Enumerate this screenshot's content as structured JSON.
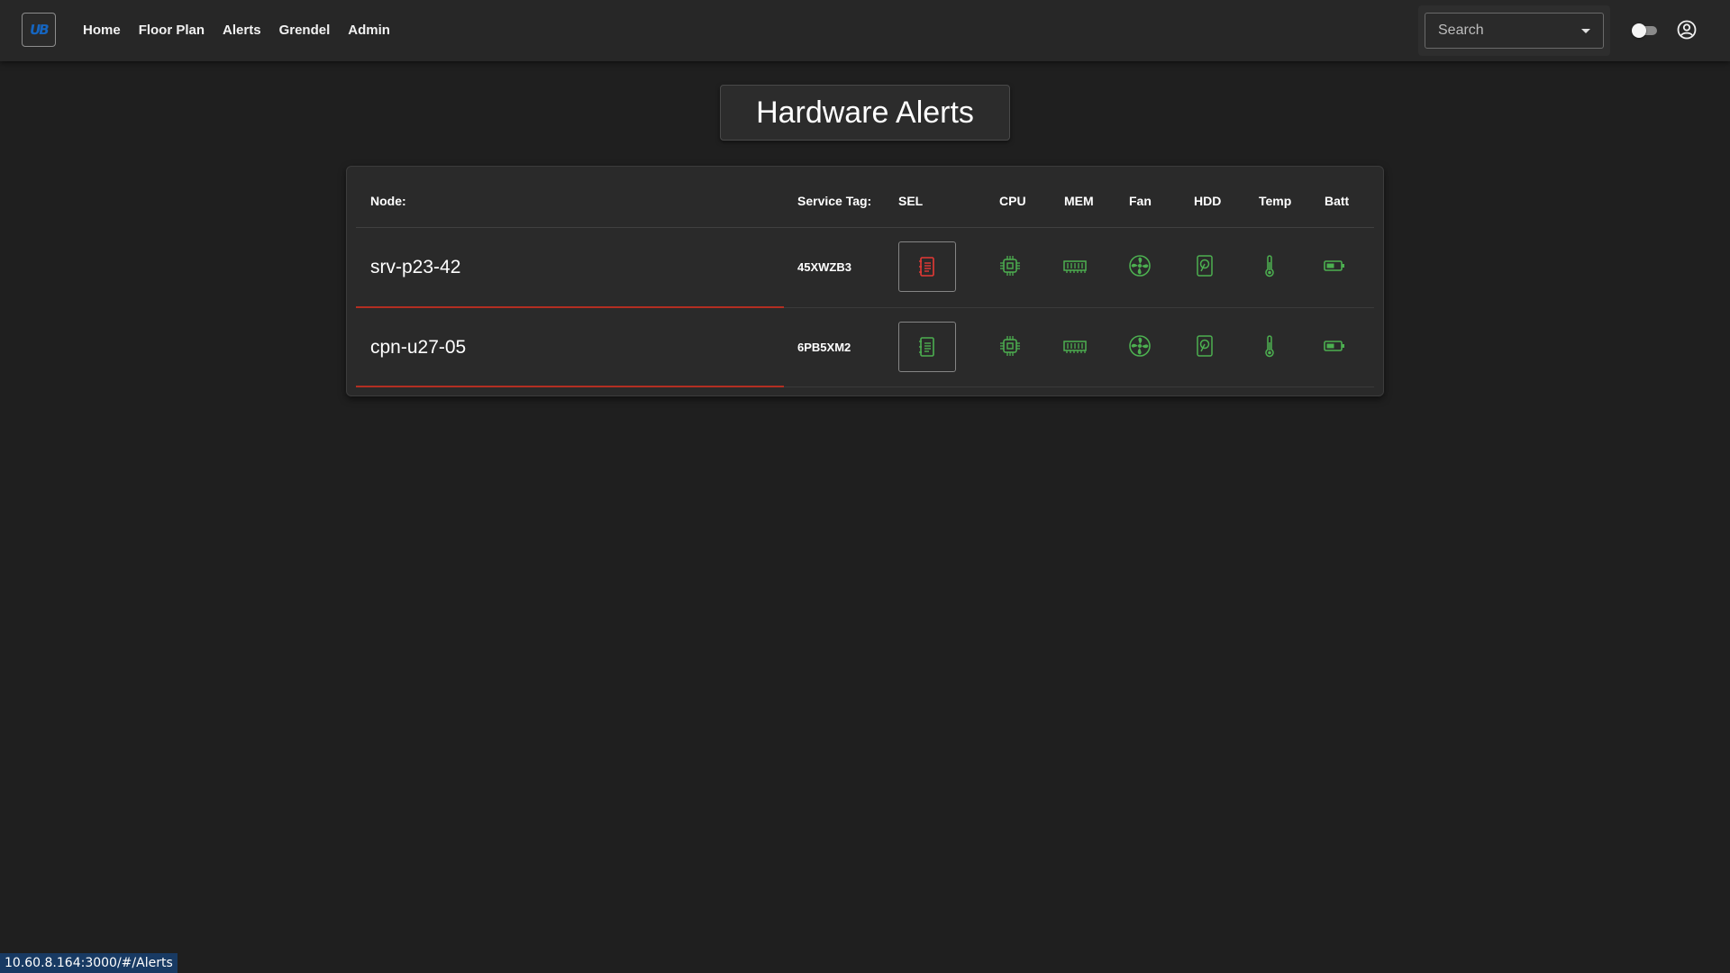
{
  "app": {
    "logo_text": "UB",
    "nav": [
      "Home",
      "Floor Plan",
      "Alerts",
      "Grendel",
      "Admin"
    ],
    "search_placeholder": "Search"
  },
  "page": {
    "title": "Hardware Alerts"
  },
  "table": {
    "headers": {
      "node": "Node:",
      "service_tag": "Service Tag:",
      "sel": "SEL",
      "cpu": "CPU",
      "mem": "MEM",
      "fan": "Fan",
      "hdd": "HDD",
      "temp": "Temp",
      "batt": "Batt"
    },
    "rows": [
      {
        "node": "srv-p23-42",
        "service_tag": "45XWZB3",
        "sel_status": "alert",
        "cpu": "ok",
        "mem": "ok",
        "fan": "ok",
        "hdd": "ok",
        "temp": "ok",
        "batt": "ok"
      },
      {
        "node": "cpn-u27-05",
        "service_tag": "6PB5XM2",
        "sel_status": "ok",
        "cpu": "ok",
        "mem": "ok",
        "fan": "ok",
        "hdd": "ok",
        "temp": "ok",
        "batt": "ok"
      }
    ]
  },
  "status_bar": {
    "url": "10.60.8.164:3000/#/Alerts"
  },
  "colors": {
    "ok": "#4caf50",
    "alert": "#e53935",
    "row_underline": "#b32e22",
    "background": "#1f1f1f"
  },
  "icons": [
    "logo-icon",
    "dropdown-arrow-icon",
    "theme-toggle",
    "account-icon",
    "document-list-icon",
    "cpu-chip-icon",
    "memory-module-icon",
    "fan-icon",
    "hard-drive-icon",
    "thermometer-icon",
    "battery-icon"
  ]
}
